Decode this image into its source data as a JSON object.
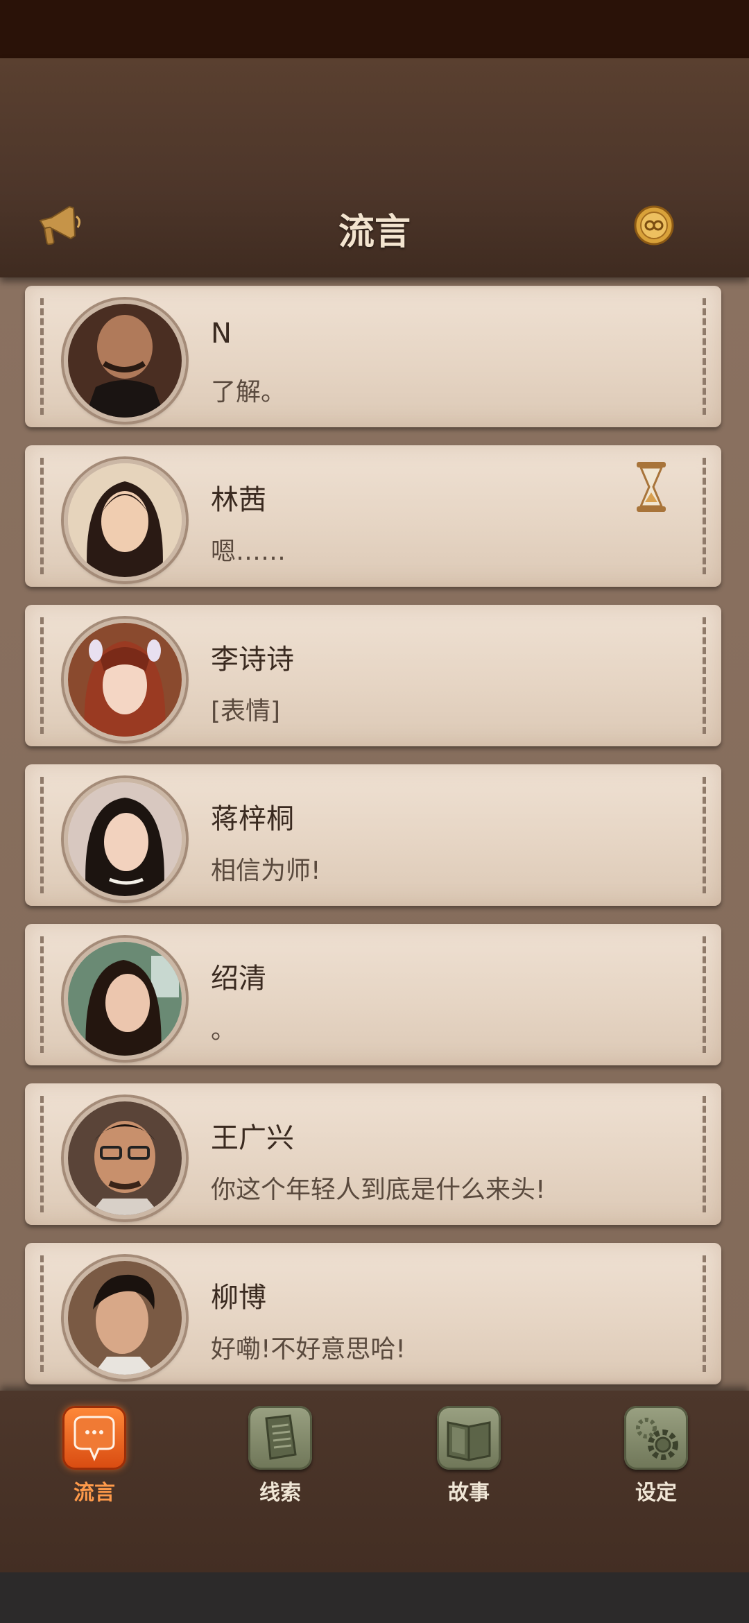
{
  "header": {
    "title": "流言",
    "left_icon": "horn-icon",
    "right_icon": "coin-icon"
  },
  "contacts": [
    {
      "name": "N",
      "message": "了解。"
    },
    {
      "name": "林茜",
      "message": "嗯……",
      "badge": "hourglass-icon"
    },
    {
      "name": "李诗诗",
      "message": "[表情]"
    },
    {
      "name": "蒋梓桐",
      "message": "相信为师!"
    },
    {
      "name": "绍清",
      "message": "。"
    },
    {
      "name": "王广兴",
      "message": "你这个年轻人到底是什么来头!"
    },
    {
      "name": "柳博",
      "message": "好嘞!不好意思哈!"
    }
  ],
  "nav": [
    {
      "label": "流言",
      "icon": "chat-bubble-icon",
      "active": true
    },
    {
      "label": "线索",
      "icon": "paper-icon",
      "active": false
    },
    {
      "label": "故事",
      "icon": "book-icon",
      "active": false
    },
    {
      "label": "设定",
      "icon": "gear-icon",
      "active": false
    }
  ],
  "colors": {
    "accent": "#e86a24",
    "card": "#e8d8c8",
    "header": "#4d362a"
  }
}
